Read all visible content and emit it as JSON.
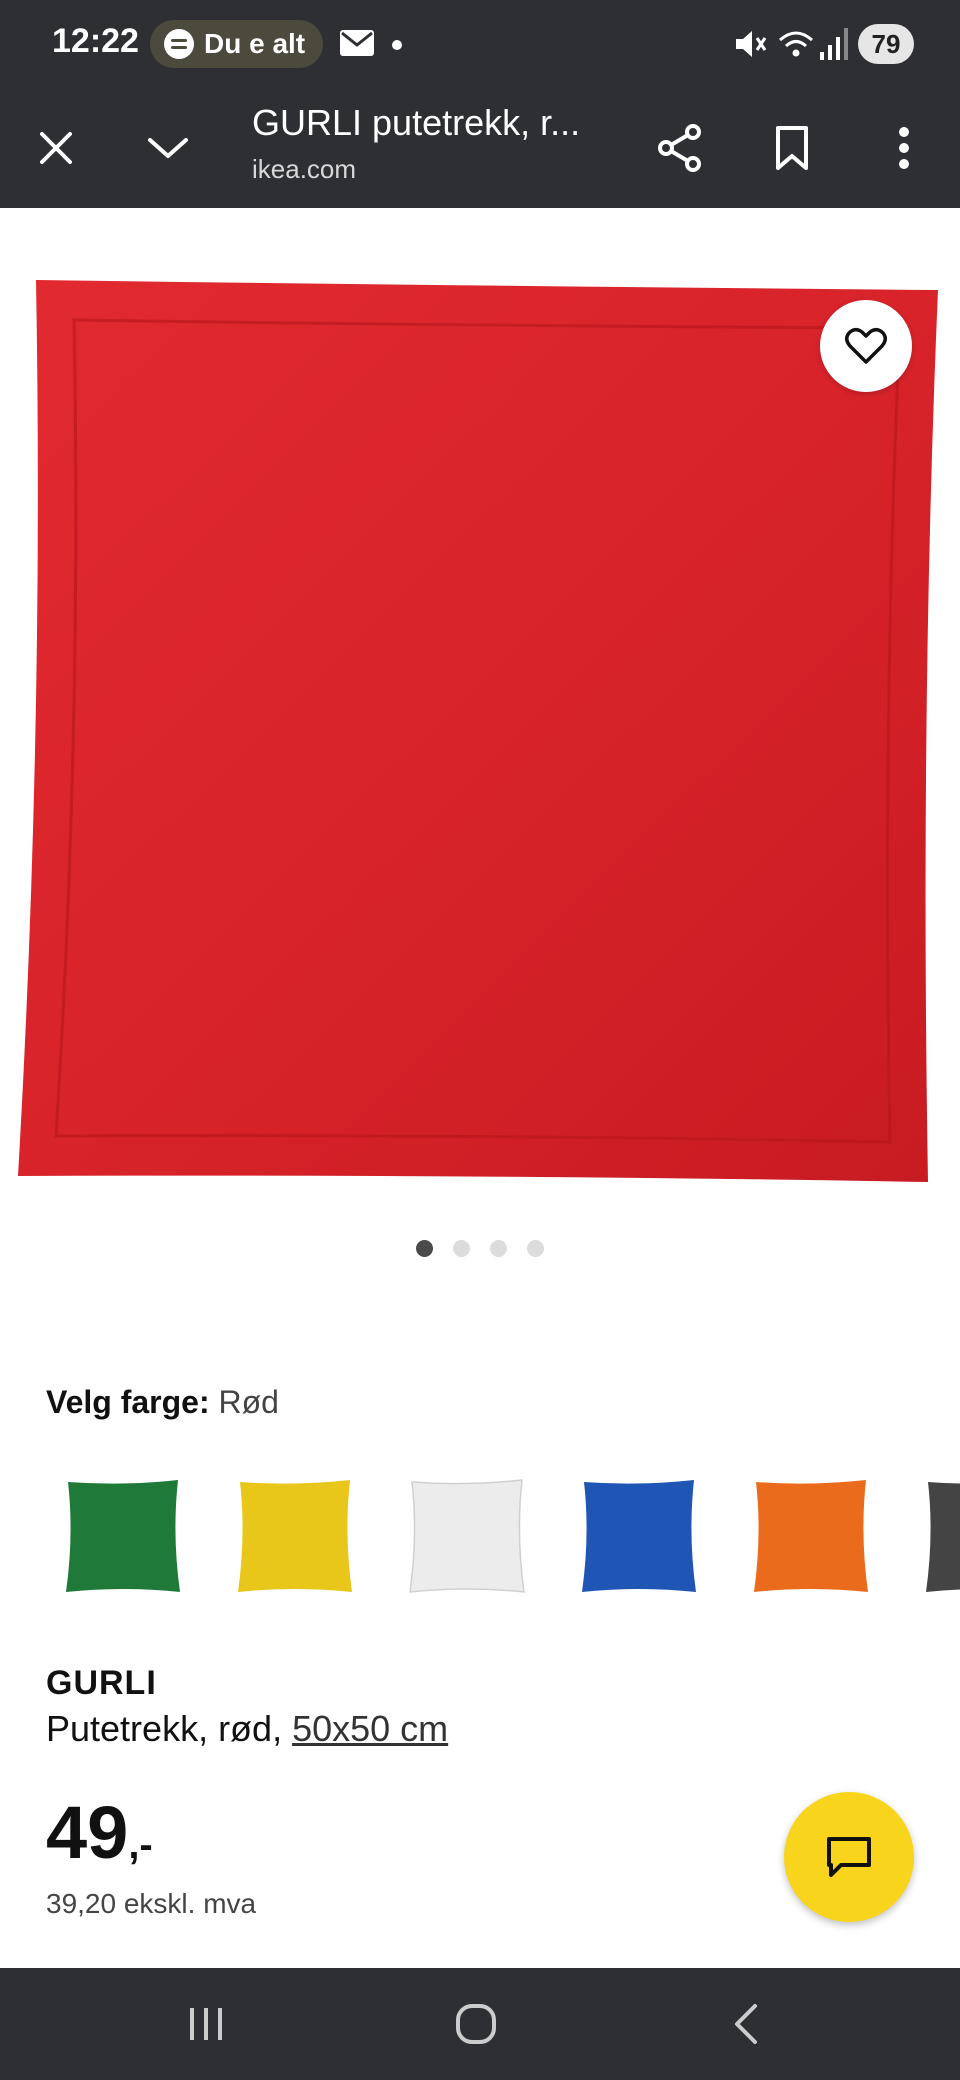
{
  "status_bar": {
    "time": "12:22",
    "spotify_text": "Du e alt",
    "battery": "79"
  },
  "toolbar": {
    "title": "GURLI putetrekk, r...",
    "url": "ikea.com"
  },
  "product_image": {
    "pager_count": 4,
    "active_index": 0,
    "color": "#d8232a"
  },
  "color_selector": {
    "label": "Velg farge:",
    "value": "Rød",
    "swatches": [
      {
        "name": "green",
        "color": "#1f7a3a"
      },
      {
        "name": "yellow",
        "color": "#e8c61a"
      },
      {
        "name": "white",
        "color": "#ececec"
      },
      {
        "name": "blue",
        "color": "#1f55b5"
      },
      {
        "name": "orange",
        "color": "#ea6b1c"
      },
      {
        "name": "dark-grey",
        "color": "#444444"
      }
    ]
  },
  "product": {
    "brand": "GURLI",
    "description": "Putetrekk, rød, ",
    "size": "50x50 cm",
    "price": "49",
    "price_suffix": ",-",
    "price_ex_vat": "39,20 ekskl. mva"
  },
  "colors": {
    "chrome": "#2d2f33",
    "fab": "#f8d51c"
  }
}
